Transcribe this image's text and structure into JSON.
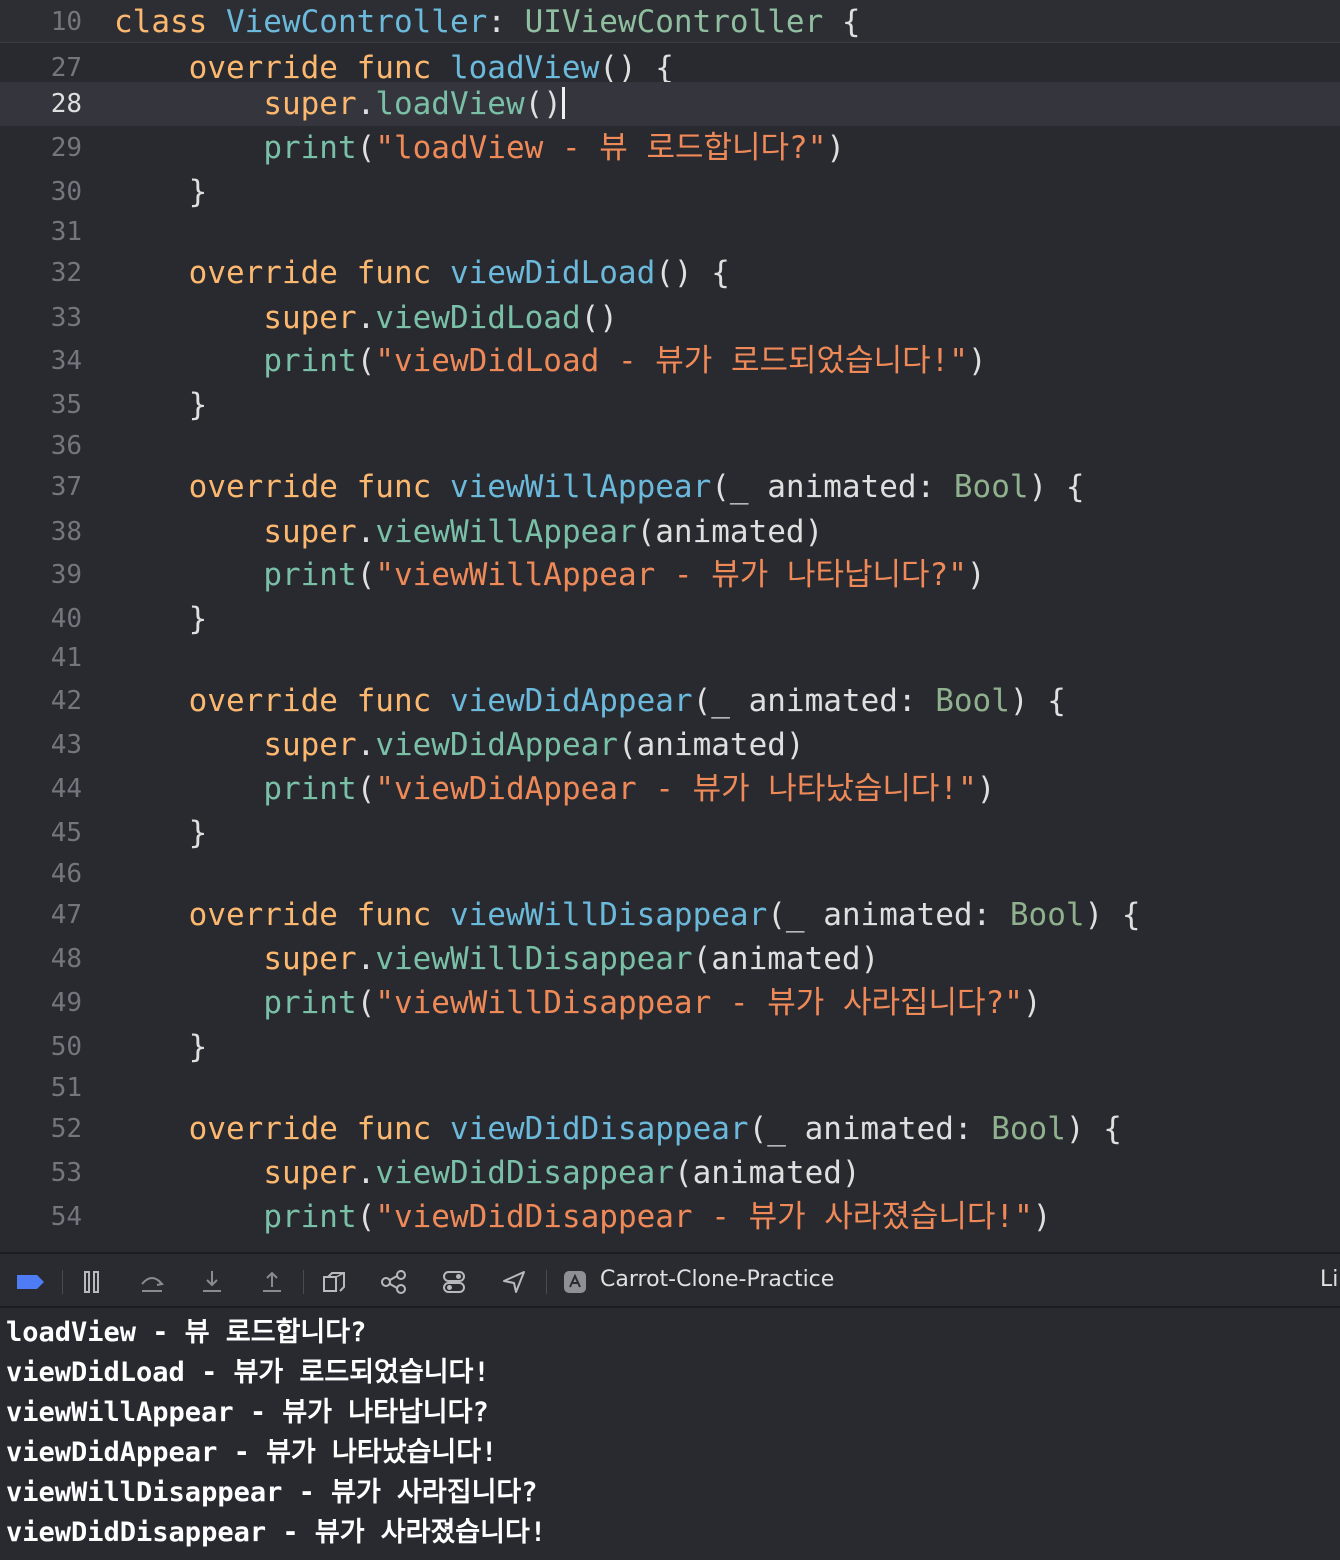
{
  "editor": {
    "lines": [
      {
        "n": "10",
        "tokens": [
          [
            "kw",
            "class "
          ],
          [
            "fn",
            "ViewController"
          ],
          [
            "pl",
            ": "
          ],
          [
            "ty",
            "UIViewController"
          ],
          [
            "pl",
            " {"
          ]
        ]
      },
      {
        "n": "27",
        "tokens": [
          [
            "pl",
            "    "
          ],
          [
            "kw",
            "override func "
          ],
          [
            "fn",
            "loadView"
          ],
          [
            "pl",
            "() {"
          ]
        ]
      },
      {
        "n": "28",
        "tokens": [
          [
            "pl",
            "        "
          ],
          [
            "kw",
            "super"
          ],
          [
            "pl",
            "."
          ],
          [
            "mem",
            "loadView"
          ],
          [
            "pl",
            "()"
          ]
        ]
      },
      {
        "n": "29",
        "tokens": [
          [
            "pl",
            "        "
          ],
          [
            "mem",
            "print"
          ],
          [
            "pl",
            "("
          ],
          [
            "str",
            "\"loadView - 뷰 로드합니다?\""
          ],
          [
            "pl",
            ")"
          ]
        ]
      },
      {
        "n": "30",
        "tokens": [
          [
            "pl",
            "    }"
          ]
        ]
      },
      {
        "n": "31",
        "tokens": []
      },
      {
        "n": "32",
        "tokens": [
          [
            "pl",
            "    "
          ],
          [
            "kw",
            "override func "
          ],
          [
            "fn",
            "viewDidLoad"
          ],
          [
            "pl",
            "() {"
          ]
        ]
      },
      {
        "n": "33",
        "tokens": [
          [
            "pl",
            "        "
          ],
          [
            "kw",
            "super"
          ],
          [
            "pl",
            "."
          ],
          [
            "mem",
            "viewDidLoad"
          ],
          [
            "pl",
            "()"
          ]
        ]
      },
      {
        "n": "34",
        "tokens": [
          [
            "pl",
            "        "
          ],
          [
            "mem",
            "print"
          ],
          [
            "pl",
            "("
          ],
          [
            "str",
            "\"viewDidLoad - 뷰가 로드되었습니다!\""
          ],
          [
            "pl",
            ")"
          ]
        ]
      },
      {
        "n": "35",
        "tokens": [
          [
            "pl",
            "    }"
          ]
        ]
      },
      {
        "n": "36",
        "tokens": []
      },
      {
        "n": "37",
        "tokens": [
          [
            "pl",
            "    "
          ],
          [
            "kw",
            "override func "
          ],
          [
            "fn",
            "viewWillAppear"
          ],
          [
            "pl",
            "(_ animated: "
          ],
          [
            "tyd",
            "Bool"
          ],
          [
            "pl",
            ") {"
          ]
        ]
      },
      {
        "n": "38",
        "tokens": [
          [
            "pl",
            "        "
          ],
          [
            "kw",
            "super"
          ],
          [
            "pl",
            "."
          ],
          [
            "mem",
            "viewWillAppear"
          ],
          [
            "pl",
            "(animated)"
          ]
        ]
      },
      {
        "n": "39",
        "tokens": [
          [
            "pl",
            "        "
          ],
          [
            "mem",
            "print"
          ],
          [
            "pl",
            "("
          ],
          [
            "str",
            "\"viewWillAppear - 뷰가 나타납니다?\""
          ],
          [
            "pl",
            ")"
          ]
        ]
      },
      {
        "n": "40",
        "tokens": [
          [
            "pl",
            "    }"
          ]
        ]
      },
      {
        "n": "41",
        "tokens": []
      },
      {
        "n": "42",
        "tokens": [
          [
            "pl",
            "    "
          ],
          [
            "kw",
            "override func "
          ],
          [
            "fn",
            "viewDidAppear"
          ],
          [
            "pl",
            "(_ animated: "
          ],
          [
            "tyd",
            "Bool"
          ],
          [
            "pl",
            ") {"
          ]
        ]
      },
      {
        "n": "43",
        "tokens": [
          [
            "pl",
            "        "
          ],
          [
            "kw",
            "super"
          ],
          [
            "pl",
            "."
          ],
          [
            "mem",
            "viewDidAppear"
          ],
          [
            "pl",
            "(animated)"
          ]
        ]
      },
      {
        "n": "44",
        "tokens": [
          [
            "pl",
            "        "
          ],
          [
            "mem",
            "print"
          ],
          [
            "pl",
            "("
          ],
          [
            "str",
            "\"viewDidAppear - 뷰가 나타났습니다!\""
          ],
          [
            "pl",
            ")"
          ]
        ]
      },
      {
        "n": "45",
        "tokens": [
          [
            "pl",
            "    }"
          ]
        ]
      },
      {
        "n": "46",
        "tokens": []
      },
      {
        "n": "47",
        "tokens": [
          [
            "pl",
            "    "
          ],
          [
            "kw",
            "override func "
          ],
          [
            "fn",
            "viewWillDisappear"
          ],
          [
            "pl",
            "(_ animated: "
          ],
          [
            "tyd",
            "Bool"
          ],
          [
            "pl",
            ") {"
          ]
        ]
      },
      {
        "n": "48",
        "tokens": [
          [
            "pl",
            "        "
          ],
          [
            "kw",
            "super"
          ],
          [
            "pl",
            "."
          ],
          [
            "mem",
            "viewWillDisappear"
          ],
          [
            "pl",
            "(animated)"
          ]
        ]
      },
      {
        "n": "49",
        "tokens": [
          [
            "pl",
            "        "
          ],
          [
            "mem",
            "print"
          ],
          [
            "pl",
            "("
          ],
          [
            "str",
            "\"viewWillDisappear - 뷰가 사라집니다?\""
          ],
          [
            "pl",
            ")"
          ]
        ]
      },
      {
        "n": "50",
        "tokens": [
          [
            "pl",
            "    }"
          ]
        ]
      },
      {
        "n": "51",
        "tokens": []
      },
      {
        "n": "52",
        "tokens": [
          [
            "pl",
            "    "
          ],
          [
            "kw",
            "override func "
          ],
          [
            "fn",
            "viewDidDisappear"
          ],
          [
            "pl",
            "(_ animated: "
          ],
          [
            "tyd",
            "Bool"
          ],
          [
            "pl",
            ") {"
          ]
        ]
      },
      {
        "n": "53",
        "tokens": [
          [
            "pl",
            "        "
          ],
          [
            "kw",
            "super"
          ],
          [
            "pl",
            "."
          ],
          [
            "mem",
            "viewDidDisappear"
          ],
          [
            "pl",
            "(animated)"
          ]
        ]
      },
      {
        "n": "54",
        "tokens": [
          [
            "pl",
            "        "
          ],
          [
            "mem",
            "print"
          ],
          [
            "pl",
            "("
          ],
          [
            "str",
            "\"viewDidDisappear - 뷰가 사라졌습니다!\""
          ],
          [
            "pl",
            ")"
          ]
        ]
      }
    ],
    "current_line": "28"
  },
  "toolbar": {
    "target_name": "Carrot-Clone-Practice",
    "overflow_text": "Li",
    "icons": [
      "breakpoint-toggle-icon",
      "pause-icon",
      "step-over-icon",
      "step-into-icon",
      "step-out-icon",
      "view-hierarchy-icon",
      "memory-graph-icon",
      "environment-overrides-icon",
      "location-icon",
      "app-target-icon"
    ]
  },
  "console": {
    "lines": [
      "loadView - 뷰 로드합니다?",
      "viewDidLoad - 뷰가 로드되었습니다!",
      "viewWillAppear - 뷰가 나타납니다?",
      "viewDidAppear - 뷰가 나타났습니다!",
      "viewWillDisappear - 뷰가 사라집니다?",
      "viewDidDisappear - 뷰가 사라졌습니다!"
    ]
  },
  "colors": {
    "background": "#292a30",
    "keyword": "#fcb86f",
    "function": "#6bb9db",
    "string": "#ef8a58",
    "member": "#79c0a6",
    "breakpoint_active": "#4d7cf4"
  }
}
